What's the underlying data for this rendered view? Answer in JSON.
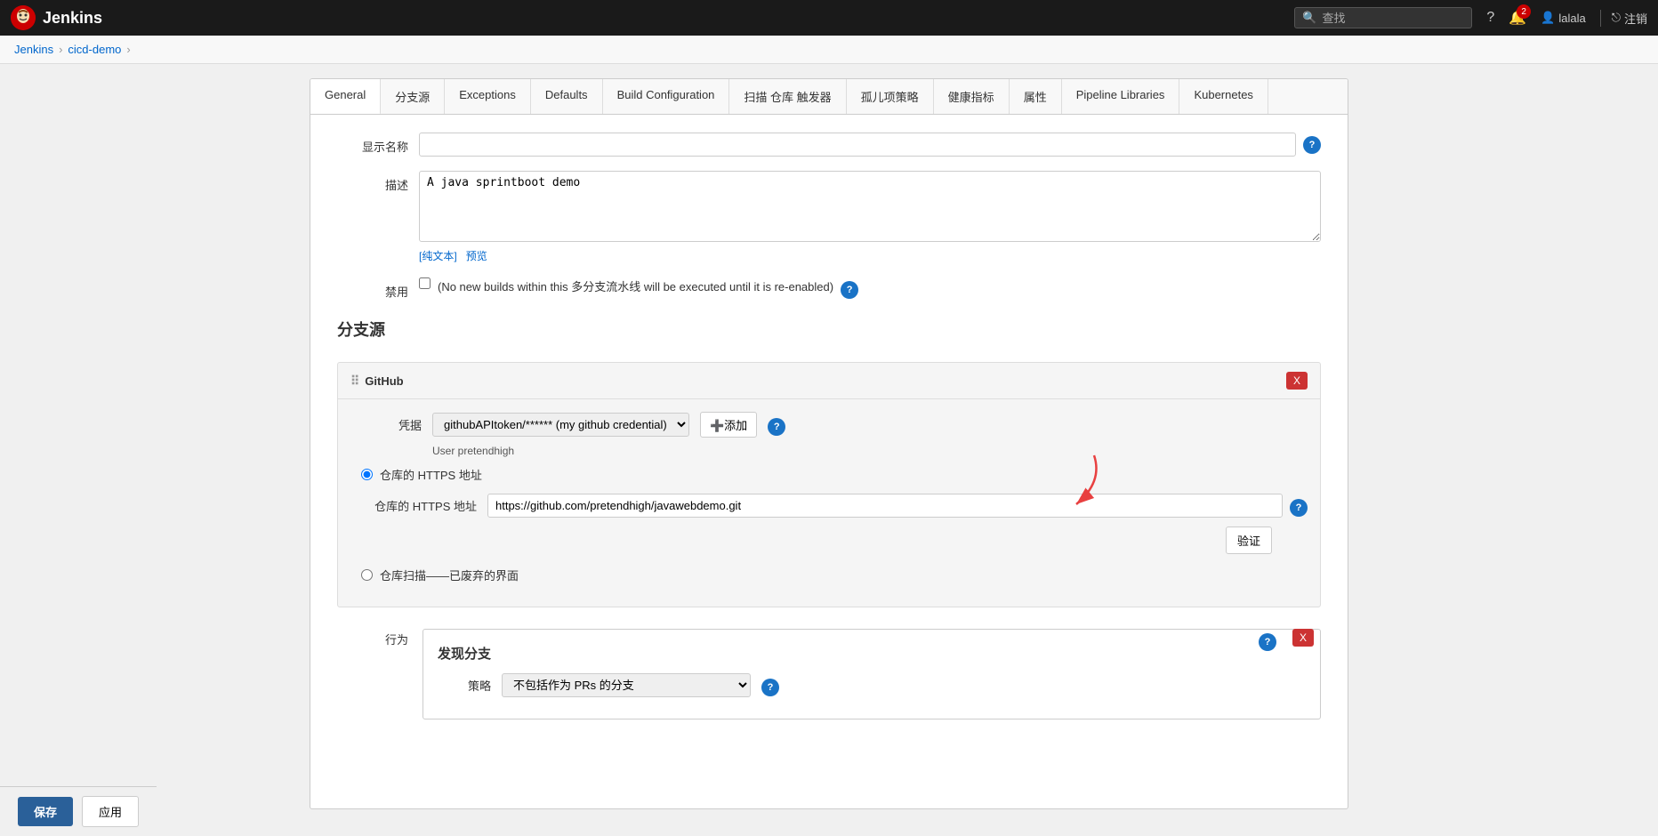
{
  "topnav": {
    "brand": "Jenkins",
    "search_placeholder": "查找",
    "notifications_count": "2",
    "user_name": "lalala",
    "logout_label": "注销"
  },
  "breadcrumb": {
    "jenkins_label": "Jenkins",
    "project_label": "cicd-demo"
  },
  "tabs": [
    {
      "id": "general",
      "label": "General",
      "active": true
    },
    {
      "id": "branch-sources",
      "label": "分支源"
    },
    {
      "id": "exceptions",
      "label": "Exceptions"
    },
    {
      "id": "defaults",
      "label": "Defaults"
    },
    {
      "id": "build-config",
      "label": "Build Configuration"
    },
    {
      "id": "scan-trigger",
      "label": "扫描 仓库 触发器"
    },
    {
      "id": "orphan-policy",
      "label": "孤儿项策略"
    },
    {
      "id": "health-metrics",
      "label": "健康指标"
    },
    {
      "id": "properties",
      "label": "属性"
    },
    {
      "id": "pipeline-libraries",
      "label": "Pipeline Libraries"
    },
    {
      "id": "kubernetes",
      "label": "Kubernetes"
    }
  ],
  "form": {
    "display_name_label": "显示名称",
    "display_name_placeholder": "",
    "description_label": "描述",
    "description_value": "A java sprintboot demo",
    "richtext_label": "[纯文本]",
    "preview_label": "预览",
    "disabled_label": "禁用",
    "disabled_checkbox_text": "(No new builds within this 多分支流水线 will be executed until it is re-enabled)"
  },
  "branch_source": {
    "section_title": "分支源",
    "github_title": "GitHub",
    "credentials_label": "凭据",
    "credentials_value": "githubAPItoken/****** (my github credential)",
    "add_button_label": "➕添加",
    "user_info": "User pretendhigh",
    "repo_https_radio_label": "仓库的 HTTPS 地址",
    "repo_https_url_label": "仓库的 HTTPS 地址",
    "repo_https_url_value": "https://github.com/pretendhigh/javawebdemo.git",
    "validate_button": "验证",
    "scan_deprecated_label": "仓库扫描——已废弃的界面",
    "behavior_label": "行为"
  },
  "discover_section": {
    "title": "发现分支",
    "strategy_label": "策略",
    "strategy_value": "不包括作为 PRs 的分支"
  },
  "bottom_actions": {
    "save_label": "保存",
    "apply_label": "应用"
  },
  "icons": {
    "search": "🔍",
    "question": "?",
    "bell": "🔔",
    "user": "👤",
    "logout": "⎋",
    "drag": "⠿",
    "close": "X",
    "add": "+"
  }
}
